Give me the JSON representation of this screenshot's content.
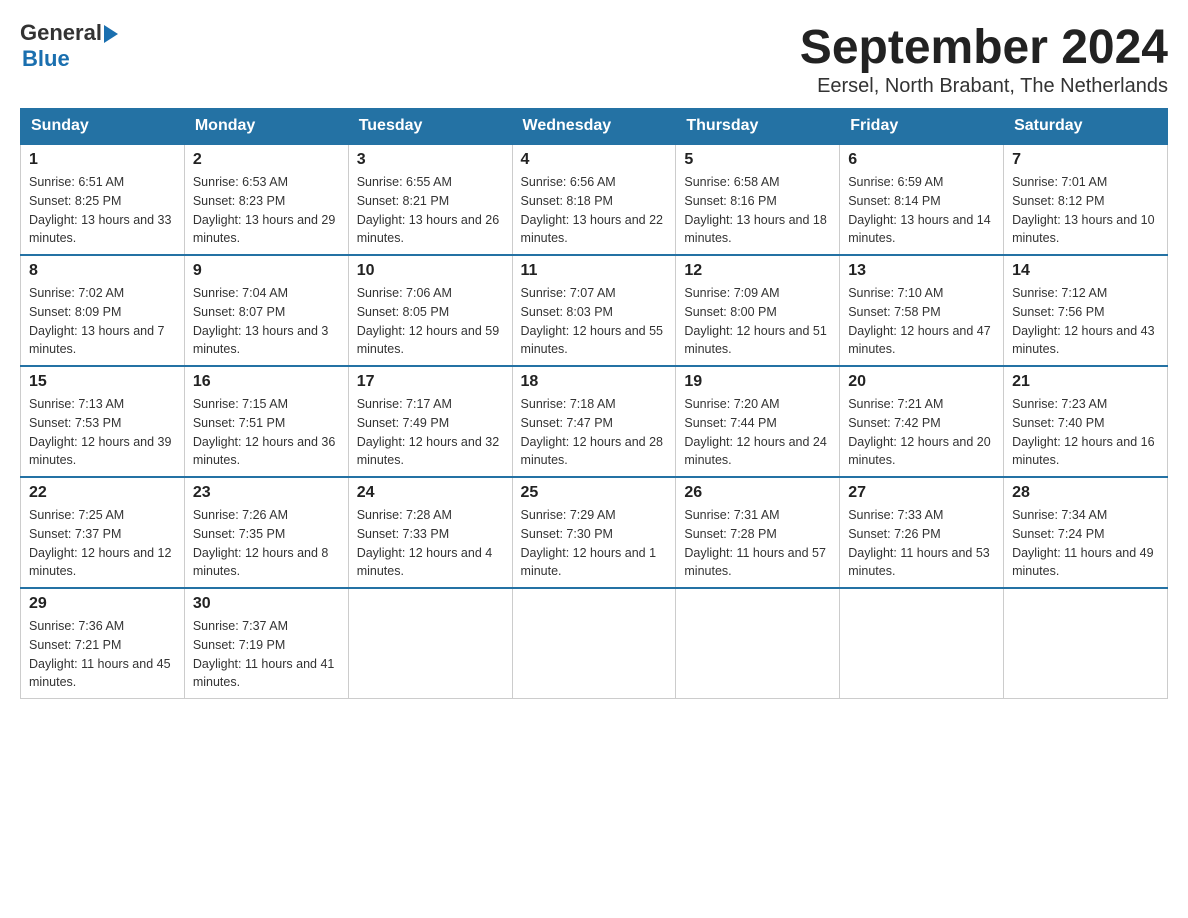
{
  "header": {
    "logo_general": "General",
    "logo_blue": "Blue",
    "month_year": "September 2024",
    "location": "Eersel, North Brabant, The Netherlands"
  },
  "days_of_week": [
    "Sunday",
    "Monday",
    "Tuesday",
    "Wednesday",
    "Thursday",
    "Friday",
    "Saturday"
  ],
  "weeks": [
    [
      {
        "day": 1,
        "sunrise": "6:51 AM",
        "sunset": "8:25 PM",
        "daylight": "13 hours and 33 minutes."
      },
      {
        "day": 2,
        "sunrise": "6:53 AM",
        "sunset": "8:23 PM",
        "daylight": "13 hours and 29 minutes."
      },
      {
        "day": 3,
        "sunrise": "6:55 AM",
        "sunset": "8:21 PM",
        "daylight": "13 hours and 26 minutes."
      },
      {
        "day": 4,
        "sunrise": "6:56 AM",
        "sunset": "8:18 PM",
        "daylight": "13 hours and 22 minutes."
      },
      {
        "day": 5,
        "sunrise": "6:58 AM",
        "sunset": "8:16 PM",
        "daylight": "13 hours and 18 minutes."
      },
      {
        "day": 6,
        "sunrise": "6:59 AM",
        "sunset": "8:14 PM",
        "daylight": "13 hours and 14 minutes."
      },
      {
        "day": 7,
        "sunrise": "7:01 AM",
        "sunset": "8:12 PM",
        "daylight": "13 hours and 10 minutes."
      }
    ],
    [
      {
        "day": 8,
        "sunrise": "7:02 AM",
        "sunset": "8:09 PM",
        "daylight": "13 hours and 7 minutes."
      },
      {
        "day": 9,
        "sunrise": "7:04 AM",
        "sunset": "8:07 PM",
        "daylight": "13 hours and 3 minutes."
      },
      {
        "day": 10,
        "sunrise": "7:06 AM",
        "sunset": "8:05 PM",
        "daylight": "12 hours and 59 minutes."
      },
      {
        "day": 11,
        "sunrise": "7:07 AM",
        "sunset": "8:03 PM",
        "daylight": "12 hours and 55 minutes."
      },
      {
        "day": 12,
        "sunrise": "7:09 AM",
        "sunset": "8:00 PM",
        "daylight": "12 hours and 51 minutes."
      },
      {
        "day": 13,
        "sunrise": "7:10 AM",
        "sunset": "7:58 PM",
        "daylight": "12 hours and 47 minutes."
      },
      {
        "day": 14,
        "sunrise": "7:12 AM",
        "sunset": "7:56 PM",
        "daylight": "12 hours and 43 minutes."
      }
    ],
    [
      {
        "day": 15,
        "sunrise": "7:13 AM",
        "sunset": "7:53 PM",
        "daylight": "12 hours and 39 minutes."
      },
      {
        "day": 16,
        "sunrise": "7:15 AM",
        "sunset": "7:51 PM",
        "daylight": "12 hours and 36 minutes."
      },
      {
        "day": 17,
        "sunrise": "7:17 AM",
        "sunset": "7:49 PM",
        "daylight": "12 hours and 32 minutes."
      },
      {
        "day": 18,
        "sunrise": "7:18 AM",
        "sunset": "7:47 PM",
        "daylight": "12 hours and 28 minutes."
      },
      {
        "day": 19,
        "sunrise": "7:20 AM",
        "sunset": "7:44 PM",
        "daylight": "12 hours and 24 minutes."
      },
      {
        "day": 20,
        "sunrise": "7:21 AM",
        "sunset": "7:42 PM",
        "daylight": "12 hours and 20 minutes."
      },
      {
        "day": 21,
        "sunrise": "7:23 AM",
        "sunset": "7:40 PM",
        "daylight": "12 hours and 16 minutes."
      }
    ],
    [
      {
        "day": 22,
        "sunrise": "7:25 AM",
        "sunset": "7:37 PM",
        "daylight": "12 hours and 12 minutes."
      },
      {
        "day": 23,
        "sunrise": "7:26 AM",
        "sunset": "7:35 PM",
        "daylight": "12 hours and 8 minutes."
      },
      {
        "day": 24,
        "sunrise": "7:28 AM",
        "sunset": "7:33 PM",
        "daylight": "12 hours and 4 minutes."
      },
      {
        "day": 25,
        "sunrise": "7:29 AM",
        "sunset": "7:30 PM",
        "daylight": "12 hours and 1 minute."
      },
      {
        "day": 26,
        "sunrise": "7:31 AM",
        "sunset": "7:28 PM",
        "daylight": "11 hours and 57 minutes."
      },
      {
        "day": 27,
        "sunrise": "7:33 AM",
        "sunset": "7:26 PM",
        "daylight": "11 hours and 53 minutes."
      },
      {
        "day": 28,
        "sunrise": "7:34 AM",
        "sunset": "7:24 PM",
        "daylight": "11 hours and 49 minutes."
      }
    ],
    [
      {
        "day": 29,
        "sunrise": "7:36 AM",
        "sunset": "7:21 PM",
        "daylight": "11 hours and 45 minutes."
      },
      {
        "day": 30,
        "sunrise": "7:37 AM",
        "sunset": "7:19 PM",
        "daylight": "11 hours and 41 minutes."
      },
      null,
      null,
      null,
      null,
      null
    ]
  ]
}
